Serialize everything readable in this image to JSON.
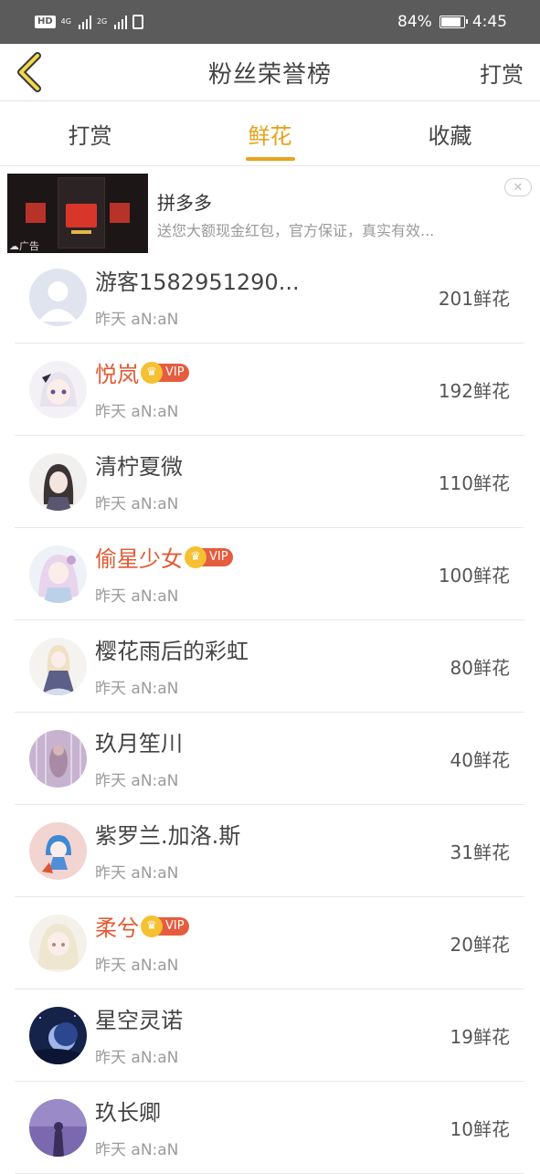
{
  "status_bar": {
    "hd": "HD",
    "net1": "4G",
    "net2": "2G",
    "battery": "84%",
    "time": "4:45"
  },
  "nav": {
    "title": "粉丝荣誉榜",
    "right": "打赏"
  },
  "tabs": [
    {
      "label": "打赏",
      "active": false
    },
    {
      "label": "鲜花",
      "active": true
    },
    {
      "label": "收藏",
      "active": false
    }
  ],
  "ad": {
    "title": "拼多多",
    "desc": "送您大额现金红包，官方保证，真实有效...",
    "label": "广告",
    "thumb_text": "100.00"
  },
  "colors": {
    "accent": "#e8a21b",
    "vip": "#e25a35"
  },
  "rows": [
    {
      "name": "游客1582951290...",
      "time": "昨天 aN:aN",
      "count": "201鲜花",
      "vip": false,
      "avatar": "default-avatar"
    },
    {
      "name": "悦岚",
      "time": "昨天 aN:aN",
      "count": "192鲜花",
      "vip": true,
      "vip_label": "VIP",
      "avatar": "anime-girl-white-hair"
    },
    {
      "name": "清柠夏微",
      "time": "昨天 aN:aN",
      "count": "110鲜花",
      "vip": false,
      "avatar": "girl-dark-hair"
    },
    {
      "name": "偷星少女",
      "time": "昨天 aN:aN",
      "count": "100鲜花",
      "vip": true,
      "vip_label": "VIP",
      "avatar": "anime-girl-pink"
    },
    {
      "name": "樱花雨后的彩虹",
      "time": "昨天 aN:aN",
      "count": "80鲜花",
      "vip": false,
      "avatar": "anime-girl-dress"
    },
    {
      "name": "玖月笙川",
      "time": "昨天 aN:aN",
      "count": "40鲜花",
      "vip": false,
      "avatar": "purple-rain"
    },
    {
      "name": "紫罗兰.加洛.斯",
      "time": "昨天 aN:aN",
      "count": "31鲜花",
      "vip": false,
      "avatar": "blue-hair-chibi"
    },
    {
      "name": "柔兮",
      "time": "昨天 aN:aN",
      "count": "20鲜花",
      "vip": true,
      "vip_label": "VIP",
      "avatar": "anime-girl-blonde"
    },
    {
      "name": "星空灵诺",
      "time": "昨天 aN:aN",
      "count": "19鲜花",
      "vip": false,
      "avatar": "night-sky-moon"
    },
    {
      "name": "玖长卿",
      "time": "昨天 aN:aN",
      "count": "10鲜花",
      "vip": false,
      "avatar": "purple-figure"
    }
  ]
}
